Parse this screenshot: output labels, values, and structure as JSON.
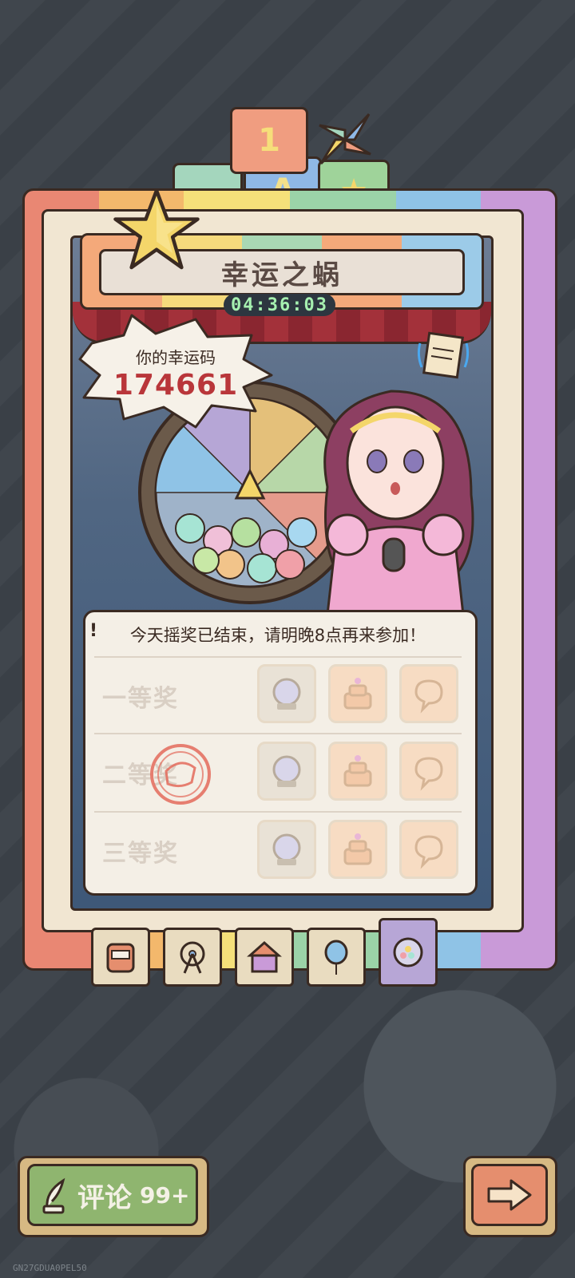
{
  "game": {
    "title": "幸运之蜗",
    "timer": "04:36:03",
    "top_blocks": [
      "1",
      "A",
      "★"
    ]
  },
  "lucky": {
    "label": "你的幸运码",
    "code": "174661"
  },
  "prize_panel": {
    "excl": "!",
    "message": "今天摇奖已结束，请明晚8点再来参加！",
    "tiers": [
      {
        "label": "一等奖",
        "prizes": [
          "globe-icon",
          "cake-icon",
          "bubble-icon"
        ]
      },
      {
        "label": "二等奖",
        "prizes": [
          "globe-icon",
          "cake-icon",
          "bubble-icon"
        ]
      },
      {
        "label": "三等奖",
        "prizes": [
          "globe-icon",
          "cake-icon",
          "bubble-icon"
        ]
      }
    ]
  },
  "tabs": [
    {
      "icon": "slot-machine-icon",
      "active": false
    },
    {
      "icon": "ferris-wheel-icon",
      "active": false
    },
    {
      "icon": "circus-tent-icon",
      "active": false
    },
    {
      "icon": "balloon-icon",
      "active": false
    },
    {
      "icon": "lottery-ball-icon",
      "active": true
    }
  ],
  "footer": {
    "comment_label": "评论",
    "comment_count": "99+",
    "build_id": "GN27GDUA0PEL50"
  },
  "colors": {
    "accent_red": "#b9363a",
    "timer_green": "#a6f0b0",
    "comment_green": "#8fb56f",
    "next_orange": "#e58e6e"
  }
}
